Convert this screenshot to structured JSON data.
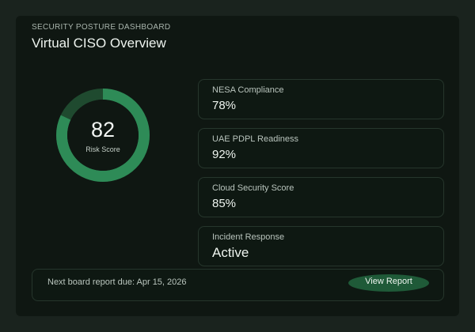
{
  "header": {
    "eyebrow": "SECURITY POSTURE DASHBOARD",
    "title": "Virtual CISO Overview"
  },
  "risk_score": {
    "value": "82",
    "label": "Risk Score",
    "level": 82,
    "ring_color": "#2e8b57"
  },
  "metrics": [
    {
      "label": "NESA Compliance",
      "value": "78%"
    },
    {
      "label": "UAE PDPL Readiness",
      "value": "92%"
    },
    {
      "label": "Cloud Security Score",
      "value": "85%"
    },
    {
      "label": "Incident Response",
      "value": "Active"
    }
  ],
  "footer": {
    "text": "Next board report due: Apr 15, 2026",
    "button_label": "View Report"
  },
  "colors": {
    "background": "#1a231e",
    "panel": "#0f1712",
    "card_border": "#26362c",
    "accent": "#2e8b57",
    "button": "#1f5a38"
  }
}
